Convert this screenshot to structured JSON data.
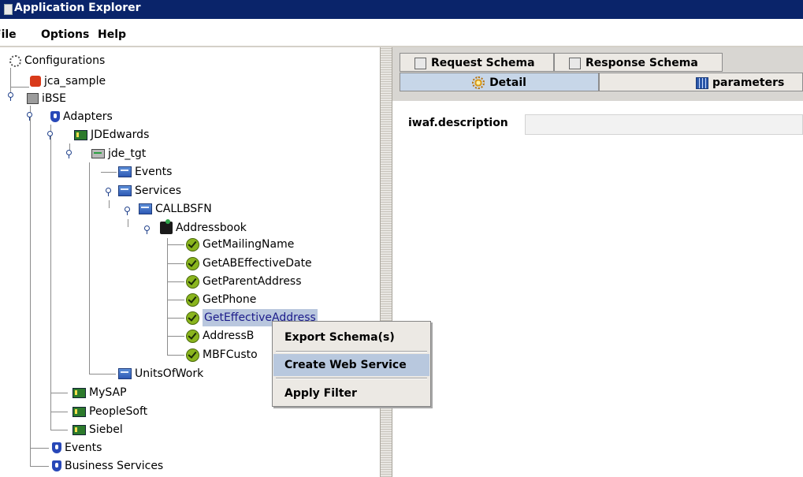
{
  "window": {
    "title": "Application Explorer"
  },
  "menu": {
    "file": "File",
    "options": "Options",
    "help": "Help"
  },
  "tree": {
    "root": "Configurations",
    "jca_sample": "jca_sample",
    "ibse": "iBSE",
    "adapters": "Adapters",
    "jdedwards": "JDEdwards",
    "jde_tgt": "jde_tgt",
    "events": "Events",
    "services": "Services",
    "callbsfn": "CALLBSFN",
    "addressbook": "Addressbook",
    "methods": [
      "GetMailingName",
      "GetABEffectiveDate",
      "GetParentAddress",
      "GetPhone",
      "GetEffectiveAddress",
      "AddressB",
      "MBFCusto"
    ],
    "unitsofwork": "UnitsOfWork",
    "mysap": "MySAP",
    "peoplesoft": "PeopleSoft",
    "siebel": "Siebel",
    "ibse_events": "Events",
    "business_services": "Business Services"
  },
  "context_menu": {
    "items": [
      "Export Schema(s)",
      "Create Web Service",
      "Apply Filter"
    ],
    "highlighted": "Create Web Service"
  },
  "tabs": {
    "top": [
      "Request Schema",
      "Response Schema"
    ],
    "bottom": [
      "Detail",
      "parameters"
    ]
  },
  "detail": {
    "label": "iwaf.description",
    "value": ""
  }
}
